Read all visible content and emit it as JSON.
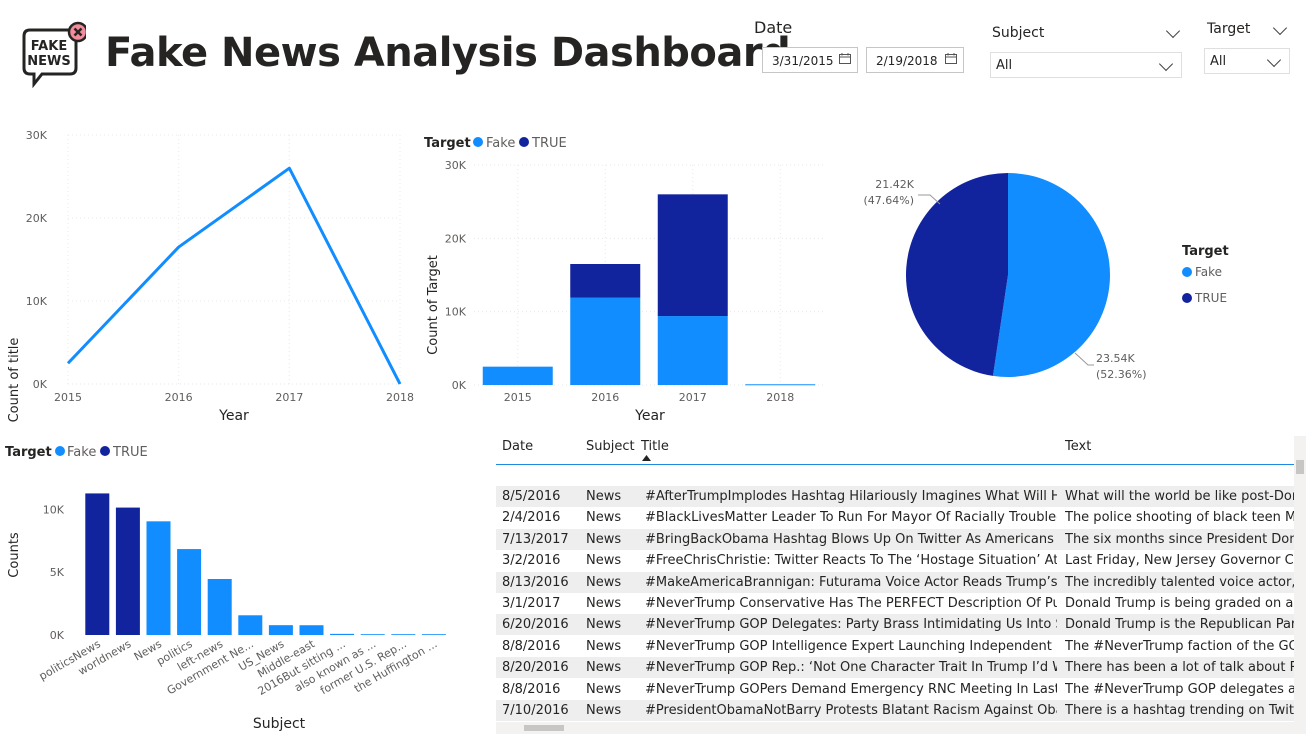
{
  "header": {
    "title": "Fake News Analysis Dashboard",
    "logo_line1": "FAKE",
    "logo_line2": "NEWS",
    "logo_icon": "x-circle-icon"
  },
  "slicers": {
    "date": {
      "label": "Date",
      "start": "3/31/2015",
      "end": "2/19/2018"
    },
    "subject": {
      "label": "Subject",
      "value": "All"
    },
    "target": {
      "label": "Target",
      "value": "All"
    }
  },
  "colors": {
    "fake": "#118DFF",
    "true": "#12239E"
  },
  "legend": {
    "title": "Target",
    "fake": "Fake",
    "true": "TRUE"
  },
  "chart_data": [
    {
      "type": "line",
      "categories": [
        "2015",
        "2016",
        "2017",
        "2018"
      ],
      "values": [
        2500,
        16500,
        26000,
        0
      ],
      "xlabel": "Year",
      "ylabel": "Count of title",
      "yticks": [
        "0K",
        "10K",
        "20K",
        "30K"
      ],
      "ylim": [
        0,
        30000
      ]
    },
    {
      "type": "bar",
      "stacked": true,
      "categories": [
        "2015",
        "2016",
        "2017",
        "2018"
      ],
      "series": [
        {
          "name": "Fake",
          "values": [
            2500,
            11900,
            9400,
            100
          ]
        },
        {
          "name": "TRUE",
          "values": [
            0,
            4600,
            16600,
            0
          ]
        }
      ],
      "xlabel": "Year",
      "ylabel": "Count of Target",
      "yticks": [
        "0K",
        "10K",
        "20K",
        "30K"
      ],
      "ylim": [
        0,
        30000
      ]
    },
    {
      "type": "pie",
      "series": [
        {
          "name": "Fake",
          "value": 23540,
          "label": "23.54K",
          "pct": "(52.36%)"
        },
        {
          "name": "TRUE",
          "value": 21420,
          "label": "21.42K",
          "pct": "(47.64%)"
        }
      ],
      "legend_position": "right"
    },
    {
      "type": "bar",
      "categories": [
        "politicsNews",
        "worldnews",
        "News",
        "politics",
        "left-news",
        "Government Ne...",
        "US_News",
        "Middle-east",
        "2016But sitting ...",
        "also known as ...",
        "former U.S. Rep...",
        "the Huffington ..."
      ],
      "values": [
        11272,
        10145,
        9050,
        6841,
        4459,
        1570,
        783,
        778,
        90,
        10,
        5,
        3
      ],
      "target": [
        "TRUE",
        "TRUE",
        "Fake",
        "Fake",
        "Fake",
        "Fake",
        "Fake",
        "Fake",
        "Fake",
        "Fake",
        "Fake",
        "Fake"
      ],
      "xlabel": "Subject",
      "ylabel": "Counts",
      "yticks": [
        "0K",
        "5K",
        "10K"
      ],
      "ylim": [
        0,
        12500
      ]
    }
  ],
  "table": {
    "headers": {
      "date": "Date",
      "subject": "Subject",
      "title": "Title",
      "text": "Text"
    },
    "rows": [
      {
        "date": "8/5/2016",
        "subject": "News",
        "title": "#AfterTrumpImplodes Hashtag Hilariously Imagines What Will Hap...",
        "text": "What will the world be like post-Donal"
      },
      {
        "date": "2/4/2016",
        "subject": "News",
        "title": "#BlackLivesMatter Leader To Run For Mayor Of Racially Troubled B...",
        "text": "The police shooting of black teen Mich"
      },
      {
        "date": "7/13/2017",
        "subject": "News",
        "title": "#BringBackObama Hashtag Blows Up On Twitter As Americans Sh...",
        "text": "The six months since President Donald"
      },
      {
        "date": "3/2/2016",
        "subject": "News",
        "title": "#FreeChrisChristie: Twitter Reacts To The ‘Hostage Situation’ At Tru...",
        "text": "Last Friday, New Jersey Governor Chris"
      },
      {
        "date": "8/13/2016",
        "subject": "News",
        "title": "#MakeAmericaBrannigan: Futurama Voice Actor Reads Trump’s M...",
        "text": "The incredibly talented voice actor, Bil"
      },
      {
        "date": "3/1/2017",
        "subject": "News",
        "title": "#NeverTrump Conservative Has The PERFECT Description Of Pundi...",
        "text": "Donald Trump is being graded on a cu"
      },
      {
        "date": "6/20/2016",
        "subject": "News",
        "title": "#NeverTrump GOP Delegates: Party Brass Intimidating Us Into Sup...",
        "text": "Donald Trump is the Republican Party"
      },
      {
        "date": "8/8/2016",
        "subject": "News",
        "title": "#NeverTrump GOP Intelligence Expert Launching Independent Bid...",
        "text": "The #NeverTrump faction of the GOP I"
      },
      {
        "date": "8/20/2016",
        "subject": "News",
        "title": "#NeverTrump GOP Rep.: ‘Not One Character Trait In Trump I’d Wa...",
        "text": "There has been a lot of talk about Rep"
      },
      {
        "date": "8/8/2016",
        "subject": "News",
        "title": "#NeverTrump GOPers Demand Emergency RNC Meeting In Last Di...",
        "text": "The #NeverTrump GOP delegates are a"
      },
      {
        "date": "7/10/2016",
        "subject": "News",
        "title": "#PresidentObamaNotBarry Protests Blatant Racism Against Obam...",
        "text": "There is a hashtag trending on Twitter"
      }
    ]
  }
}
